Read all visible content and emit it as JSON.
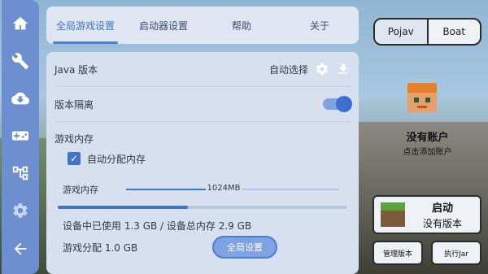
{
  "tabs": [
    "全局游戏设置",
    "启动器设置",
    "帮助",
    "关于"
  ],
  "active_tab": 0,
  "settings": {
    "java_label": "Java 版本",
    "java_value": "自动选择",
    "isolation_label": "版本隔离",
    "isolation_on": true,
    "memory_section": "游戏内存",
    "auto_memory_label": "自动分配内存",
    "auto_memory_checked": true,
    "memory_label": "游戏内存",
    "memory_value": "1024MB",
    "memory_fraction": 0.38,
    "usage_fraction": 0.45,
    "device_usage": "设备中已使用 1.3 GB / 设备总内存 2.9 GB",
    "game_alloc": "游戏分配 1.0 GB",
    "global_button": "全局设置"
  },
  "launcher": {
    "segments": [
      "Pojav",
      "Boat"
    ],
    "active_segment": 0,
    "account_name": "没有账户",
    "account_sub": "点击添加账户",
    "launch_title": "启动",
    "launch_sub": "没有版本",
    "manage_version": "管理版本",
    "run_jar": "执行Jar"
  },
  "colors": {
    "accent": "#3f74c9",
    "rail": "#6d8fcf"
  },
  "icons": [
    "home-icon",
    "wrench-icon",
    "cloud-download-icon",
    "gamepad-icon",
    "tree-icon",
    "gear-icon",
    "back-arrow-icon"
  ]
}
